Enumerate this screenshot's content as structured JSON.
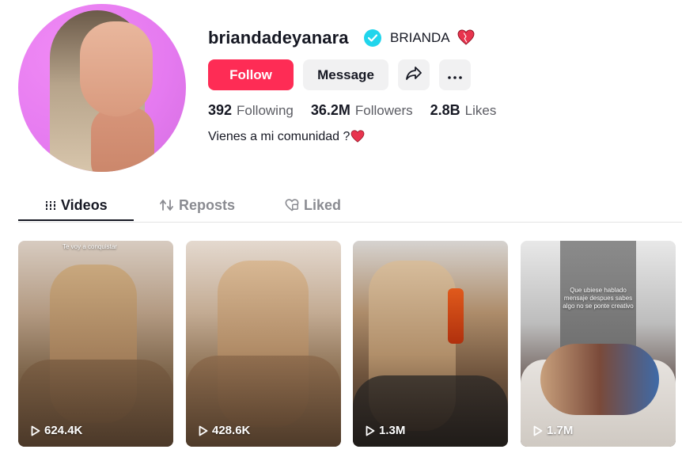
{
  "profile": {
    "username": "briandadeyanara",
    "nickname": "BRIANDA",
    "verified": true,
    "bio_text": "Vienes a mi comunidad ?",
    "accent_color": "#fe2c55",
    "verified_color": "#20d5ec"
  },
  "actions": {
    "follow_label": "Follow",
    "message_label": "Message",
    "share_icon": "share-icon",
    "more_icon": "more-icon"
  },
  "stats": [
    {
      "value": "392",
      "label": "Following"
    },
    {
      "value": "36.2M",
      "label": "Followers"
    },
    {
      "value": "2.8B",
      "label": "Likes"
    }
  ],
  "tabs": [
    {
      "label": "Videos",
      "icon": "grid-icon",
      "active": true
    },
    {
      "label": "Reposts",
      "icon": "repost-icon",
      "active": false
    },
    {
      "label": "Liked",
      "icon": "liked-heart-icon",
      "active": false
    }
  ],
  "videos": [
    {
      "views": "624.4K",
      "overlay": "Te voy a conquistar"
    },
    {
      "views": "428.6K",
      "overlay": ""
    },
    {
      "views": "1.3M",
      "overlay": ""
    },
    {
      "views": "1.7M",
      "overlay": "Que ubiese hablado mensaje despues sabes algo no se ponte creativo"
    }
  ]
}
